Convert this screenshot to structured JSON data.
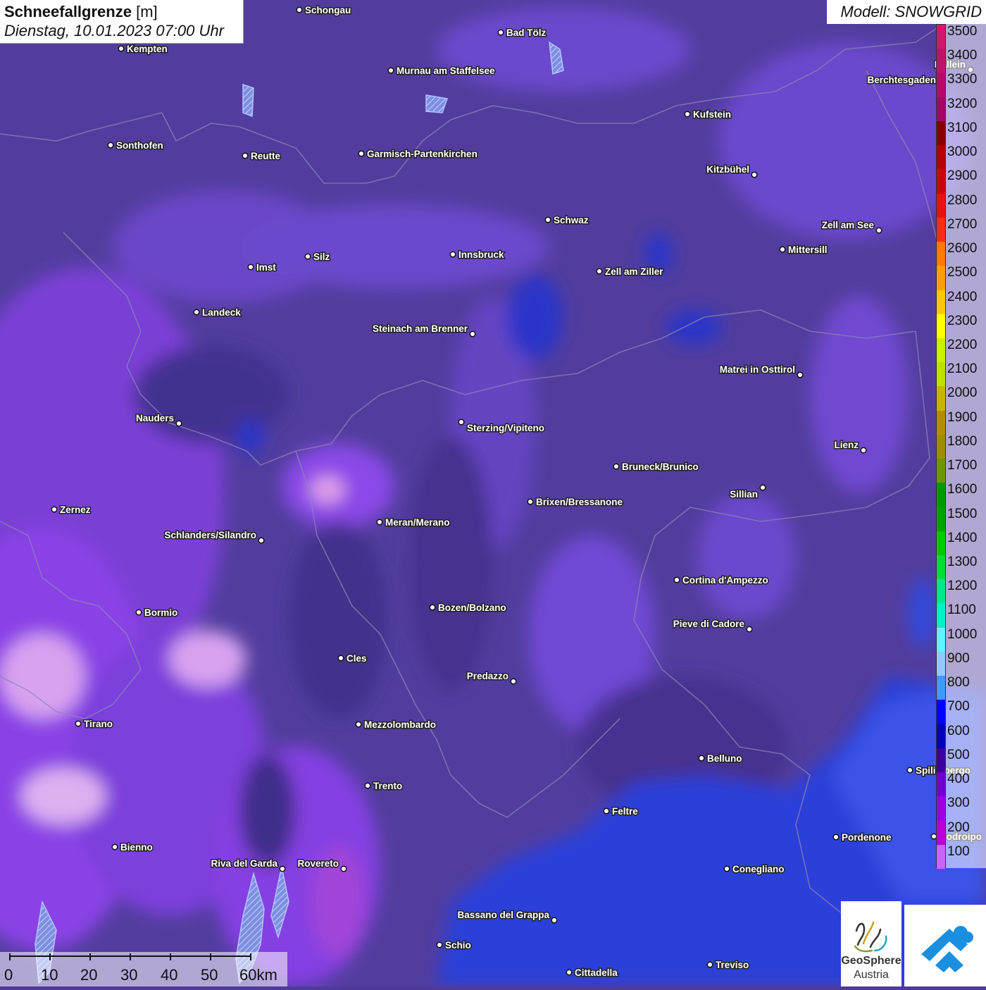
{
  "title": {
    "parameter": "Schneefallgrenze",
    "unit": "[m]",
    "datetime": "Dienstag, 10.01.2023 07:00 Uhr"
  },
  "model": "Modell: SNOWGRID",
  "legend": {
    "labels": [
      "3500",
      "3400",
      "3300",
      "3200",
      "3100",
      "3000",
      "2900",
      "2800",
      "2700",
      "2600",
      "2500",
      "2400",
      "2300",
      "2200",
      "2100",
      "2000",
      "1900",
      "1800",
      "1700",
      "1600",
      "1500",
      "1400",
      "1300",
      "1200",
      "1100",
      "1000",
      "900",
      "800",
      "700",
      "600",
      "500",
      "400",
      "300",
      "200",
      "100"
    ],
    "colors": [
      "#d4156e",
      "#c3106b",
      "#b00d6b",
      "#9e0a63",
      "#820000",
      "#b00000",
      "#d10000",
      "#ee1010",
      "#ff2b1a",
      "#ff7a00",
      "#ffa000",
      "#ffc800",
      "#ffff00",
      "#c8f000",
      "#c0e000",
      "#c8b400",
      "#b48c00",
      "#a08c00",
      "#6e9600",
      "#009600",
      "#00a000",
      "#00c800",
      "#00dc3c",
      "#00e68c",
      "#00f0c8",
      "#64f0ff",
      "#96c8ff",
      "#4696ff",
      "#0000ff",
      "#0000b4",
      "#3c0096",
      "#6e00c8",
      "#9600e6",
      "#b400d2",
      "#c864ff"
    ]
  },
  "cities": [
    {
      "name": "Schongau"
    },
    {
      "name": "Kempten"
    },
    {
      "name": "Bad Tölz"
    },
    {
      "name": "Murnau am Staffelsee"
    },
    {
      "name": "Hallein"
    },
    {
      "name": "Berchtesgaden"
    },
    {
      "name": "Kufstein"
    },
    {
      "name": "Sonthofen"
    },
    {
      "name": "Reutte"
    },
    {
      "name": "Garmisch-Partenkirchen"
    },
    {
      "name": "Kitzbühel"
    },
    {
      "name": "Schwaz"
    },
    {
      "name": "Zell am See"
    },
    {
      "name": "Innsbruck"
    },
    {
      "name": "Mittersill"
    },
    {
      "name": "Imst"
    },
    {
      "name": "Silz"
    },
    {
      "name": "Zell am Ziller"
    },
    {
      "name": "Landeck"
    },
    {
      "name": "Steinach am Brenner"
    },
    {
      "name": "Matrei in Osttirol"
    },
    {
      "name": "Nauders"
    },
    {
      "name": "Sterzing/Vipiteno"
    },
    {
      "name": "Lienz"
    },
    {
      "name": "Bruneck/Brunico"
    },
    {
      "name": "Sillian"
    },
    {
      "name": "Brixen/Bressanone"
    },
    {
      "name": "Zernez"
    },
    {
      "name": "Meran/Merano"
    },
    {
      "name": "Schlanders/Silandro"
    },
    {
      "name": "Cortina d'Ampezzo"
    },
    {
      "name": "Bozen/Bolzano"
    },
    {
      "name": "Bormio"
    },
    {
      "name": "Pieve di Cadore"
    },
    {
      "name": "Cles"
    },
    {
      "name": "Predazzo"
    },
    {
      "name": "Tirano"
    },
    {
      "name": "Mezzolombardo"
    },
    {
      "name": "Belluno"
    },
    {
      "name": "Spilimbergo"
    },
    {
      "name": "Trento"
    },
    {
      "name": "Feltre"
    },
    {
      "name": "Pordenone"
    },
    {
      "name": "Codroipo"
    },
    {
      "name": "Bienno"
    },
    {
      "name": "Riva del Garda"
    },
    {
      "name": "Rovereto"
    },
    {
      "name": "Conegliano"
    },
    {
      "name": "Bassano del Grappa"
    },
    {
      "name": "Schio"
    },
    {
      "name": "Treviso"
    },
    {
      "name": "Cittadella"
    }
  ],
  "scale": {
    "labels": [
      "0",
      "10",
      "20",
      "30",
      "40",
      "50",
      "60km"
    ]
  },
  "logo": {
    "line1": "GeoSphere",
    "line2": "Austria"
  }
}
